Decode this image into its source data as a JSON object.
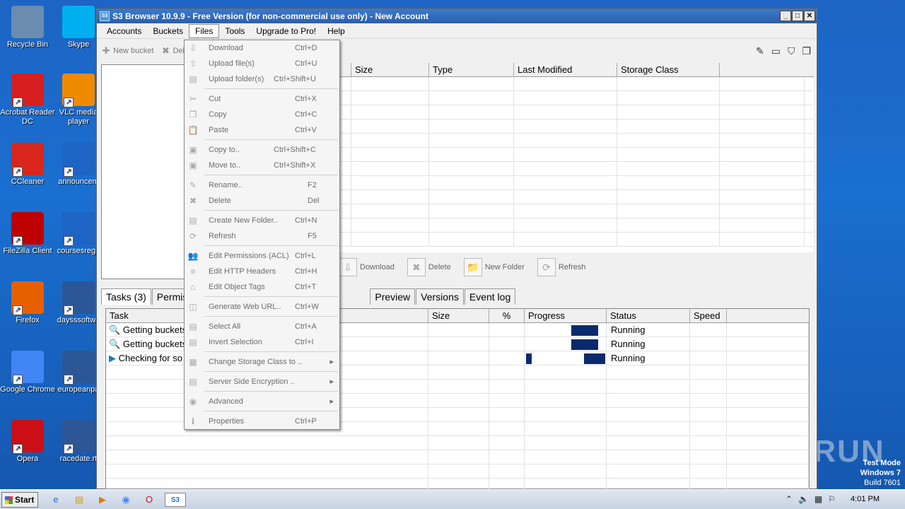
{
  "desktop": {
    "icons": [
      {
        "label": "Recycle Bin",
        "icon": "recycle-bin-icon",
        "color": "#6a8caf"
      },
      {
        "label": "Skype",
        "icon": "skype-icon",
        "color": "#00aff0"
      },
      {
        "label": "Acrobat Reader DC",
        "icon": "acrobat-icon",
        "color": "#d71f1f"
      },
      {
        "label": "VLC media player",
        "icon": "vlc-icon",
        "color": "#f08a00"
      },
      {
        "label": "CCleaner",
        "icon": "ccleaner-icon",
        "color": "#d9261c"
      },
      {
        "label": "announcem",
        "icon": "document-icon",
        "color": "#1d64c4"
      },
      {
        "label": "FileZilla Client",
        "icon": "filezilla-icon",
        "color": "#bf0000"
      },
      {
        "label": "coursesrega",
        "icon": "document-icon",
        "color": "#1d64c4"
      },
      {
        "label": "Firefox",
        "icon": "firefox-icon",
        "color": "#e66000"
      },
      {
        "label": "daysssoftwa",
        "icon": "word-icon",
        "color": "#2b5797"
      },
      {
        "label": "Google Chrome",
        "icon": "chrome-icon",
        "color": "#4285f4"
      },
      {
        "label": "europeanpa",
        "icon": "word-icon",
        "color": "#2b5797"
      },
      {
        "label": "Opera",
        "icon": "opera-icon",
        "color": "#cc0f16"
      },
      {
        "label": "racedate.rt",
        "icon": "word-icon",
        "color": "#2b5797"
      }
    ],
    "watermark": "ANY RUN",
    "test_mode": [
      "Test Mode",
      "Windows 7",
      "Build 7601"
    ]
  },
  "window": {
    "title": "S3 Browser 10.9.9 - Free Version (for non-commercial use only) - New Account",
    "app_icon": "S3",
    "controls": {
      "minimize": "_",
      "maximize": "□",
      "close": "✕"
    },
    "menu": [
      "Accounts",
      "Buckets",
      "Files",
      "Tools",
      "Upgrade to Pro!",
      "Help"
    ],
    "active_menu": "Files",
    "toolbar": {
      "new_bucket": "New bucket",
      "delete": "Del"
    },
    "file_columns": [
      "Size",
      "Type",
      "Last Modified",
      "Storage Class"
    ],
    "actions": [
      "Download",
      "Delete",
      "New Folder",
      "Refresh"
    ],
    "tabs": [
      "Tasks (3)",
      "Permis",
      "Preview",
      "Versions",
      "Event log"
    ],
    "task_columns": [
      "Task",
      "Size",
      "%",
      "Progress",
      "Status",
      "Speed"
    ],
    "tasks": [
      {
        "task": "Getting buckets",
        "status": "Running"
      },
      {
        "task": "Getting buckets",
        "status": "Running"
      },
      {
        "task": "Checking for so",
        "status": "Running"
      }
    ]
  },
  "files_menu": [
    {
      "label": "Download",
      "shortcut": "Ctrl+D",
      "icon": "download-icon"
    },
    {
      "label": "Upload file(s)",
      "shortcut": "Ctrl+U",
      "icon": "upload-icon"
    },
    {
      "label": "Upload folder(s)",
      "shortcut": "Ctrl+Shift+U",
      "icon": "upload-folder-icon"
    },
    {
      "sep": true
    },
    {
      "label": "Cut",
      "shortcut": "Ctrl+X",
      "icon": "cut-icon"
    },
    {
      "label": "Copy",
      "shortcut": "Ctrl+C",
      "icon": "copy-icon"
    },
    {
      "label": "Paste",
      "shortcut": "Ctrl+V",
      "icon": "paste-icon"
    },
    {
      "sep": true
    },
    {
      "label": "Copy to..",
      "shortcut": "Ctrl+Shift+C",
      "icon": "copy-to-icon"
    },
    {
      "label": "Move to..",
      "shortcut": "Ctrl+Shift+X",
      "icon": "move-to-icon"
    },
    {
      "sep": true
    },
    {
      "label": "Rename..",
      "shortcut": "F2",
      "icon": "rename-icon"
    },
    {
      "label": "Delete",
      "shortcut": "Del",
      "icon": "delete-icon"
    },
    {
      "sep": true
    },
    {
      "label": "Create New Folder..",
      "shortcut": "Ctrl+N",
      "icon": "new-folder-icon"
    },
    {
      "label": "Refresh",
      "shortcut": "F5",
      "icon": "refresh-icon"
    },
    {
      "sep": true
    },
    {
      "label": "Edit Permissions (ACL)",
      "shortcut": "Ctrl+L",
      "icon": "permissions-icon"
    },
    {
      "label": "Edit HTTP Headers",
      "shortcut": "Ctrl+H",
      "icon": "headers-icon"
    },
    {
      "label": "Edit Object Tags",
      "shortcut": "Ctrl+T",
      "icon": "tag-icon"
    },
    {
      "sep": true
    },
    {
      "label": "Generate Web URL..",
      "shortcut": "Ctrl+W",
      "icon": "web-url-icon"
    },
    {
      "sep": true
    },
    {
      "label": "Select All",
      "shortcut": "Ctrl+A",
      "icon": "select-all-icon"
    },
    {
      "label": "Invert Selection",
      "shortcut": "Ctrl+I",
      "icon": "invert-selection-icon"
    },
    {
      "sep": true
    },
    {
      "label": "Change Storage Class to ..",
      "shortcut": "",
      "icon": "storage-class-icon",
      "submenu": true
    },
    {
      "sep": true
    },
    {
      "label": "Server Side Encryption ..",
      "shortcut": "",
      "icon": "encryption-icon",
      "submenu": true
    },
    {
      "sep": true
    },
    {
      "label": "Advanced",
      "shortcut": "",
      "icon": "advanced-icon",
      "submenu": true
    },
    {
      "sep": true
    },
    {
      "label": "Properties",
      "shortcut": "Ctrl+P",
      "icon": "properties-icon"
    }
  ],
  "taskbar": {
    "start": "Start",
    "clock": "4:01 PM",
    "apps": [
      "ie-icon",
      "explorer-icon",
      "media-player-icon",
      "chrome-icon",
      "opera-icon",
      "s3browser-icon"
    ]
  },
  "progress": [
    0.3,
    0.3,
    0.1
  ]
}
